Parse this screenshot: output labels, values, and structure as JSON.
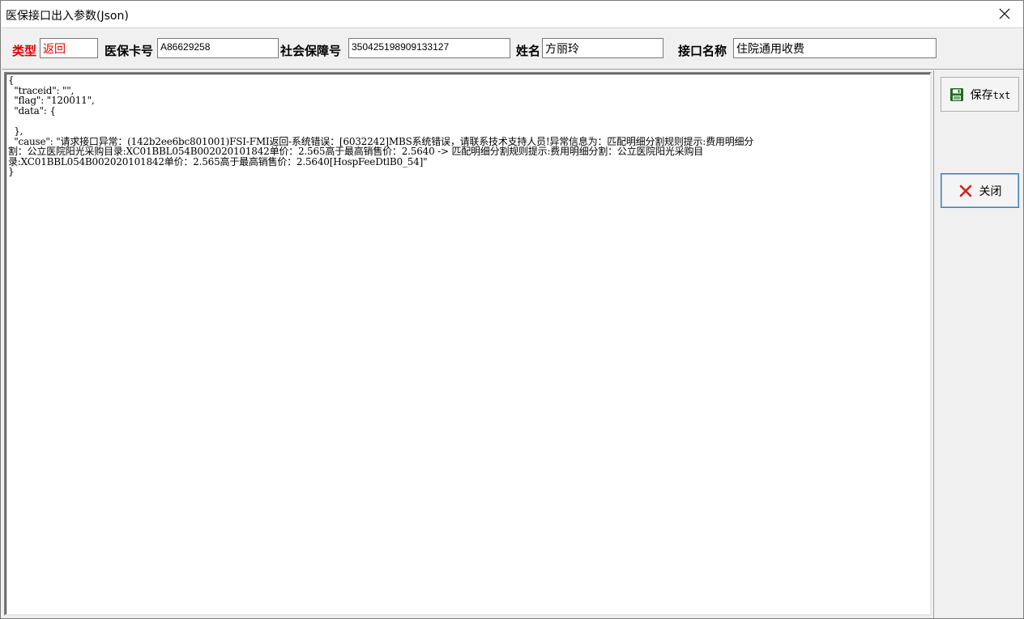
{
  "window": {
    "title": "医保接口出入参数(Json)"
  },
  "fields": {
    "type_label": "类型",
    "type_value": "返回",
    "card_label": "医保卡号",
    "card_value": "A86629258",
    "ssn_label": "社会保障号",
    "ssn_value": "350425198909133127",
    "name_label": "姓名",
    "name_value": "方丽玲",
    "api_label": "接口名称",
    "api_value": "住院通用收费"
  },
  "editor": {
    "content": "{\n  \"traceid\": \"\",\n  \"flag\": \"120011\",\n  \"data\": {\n\n  },\n  \"cause\": \"请求接口异常：(142b2ee6bc801001)FSI-FMI返回-系统错误：[6032242]MBS系统错误，请联系技术支持人员!异常信息为：匹配明细分割规则提示:费用明细分\n割：公立医院阳光采购目录:XC01BBL054B002020101842单价：2.565高于最高销售价：2.5640 -> 匹配明细分割规则提示:费用明细分割：公立医院阳光采购目\n录:XC01BBL054B002020101842单价：2.565高于最高销售价：2.5640[HospFeeDtlB0_54]\"\n}"
  },
  "buttons": {
    "save_label": "保存",
    "save_suffix": "txt",
    "close_label": "关闭"
  },
  "icons": {
    "save": "floppy-disk-icon",
    "close": "red-x-icon",
    "window_close": "close-icon"
  },
  "colors": {
    "label_red": "#e00000",
    "save_icon": "#1a6e1a",
    "close_icon": "#d81e1e"
  }
}
